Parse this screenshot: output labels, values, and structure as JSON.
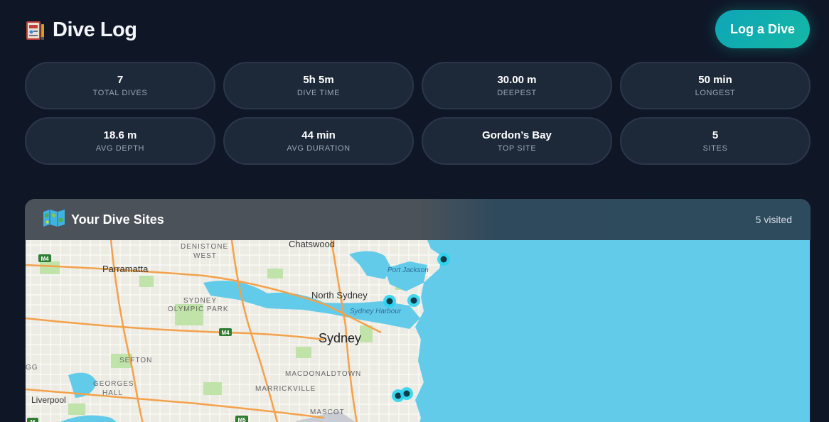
{
  "header": {
    "title": "Dive Log",
    "cta_label": "Log a Dive",
    "logo_icon": "logbook-icon"
  },
  "stats": [
    {
      "value": "7",
      "label": "Total Dives"
    },
    {
      "value": "5h 5m",
      "label": "Dive Time"
    },
    {
      "value": "30.00 m",
      "label": "Deepest"
    },
    {
      "value": "50 min",
      "label": "Longest"
    },
    {
      "value": "18.6 m",
      "label": "Avg Depth"
    },
    {
      "value": "44 min",
      "label": "Avg Duration"
    },
    {
      "value": "Gordon’s Bay",
      "label": "Top Site"
    },
    {
      "value": "5",
      "label": "Sites"
    }
  ],
  "map": {
    "title": "Your Dive Sites",
    "count_label": "5 visited",
    "icon": "world-map-icon",
    "labels": {
      "chatswood": "Chatswood",
      "denistone": "DENISTONE",
      "west": "WEST",
      "parramatta": "Parramatta",
      "port_jackson": "Port Jackson",
      "north_sydney": "North Sydney",
      "sydney_olympic_1": "SYDNEY",
      "sydney_olympic_2": "OLYMPIC PARK",
      "sydney_harbour": "Sydney Harbour",
      "sydney": "Sydney",
      "sefton": "SEFTON",
      "ggs": "GG",
      "georges_1": "GEORGES",
      "georges_2": "HALL",
      "macdonaldtown": "MACDONALDTOWN",
      "marrickville": "MARRICKVILLE",
      "liverpool": "Liverpool",
      "mascot": "MASCOT",
      "m4a": "M4",
      "m4b": "M4",
      "m5": "M5",
      "m7": "M"
    },
    "colors": {
      "ocean": "#63cbea",
      "land": "#ecebe4",
      "marker": "#22d3ee",
      "road": "#f4a14a"
    }
  }
}
